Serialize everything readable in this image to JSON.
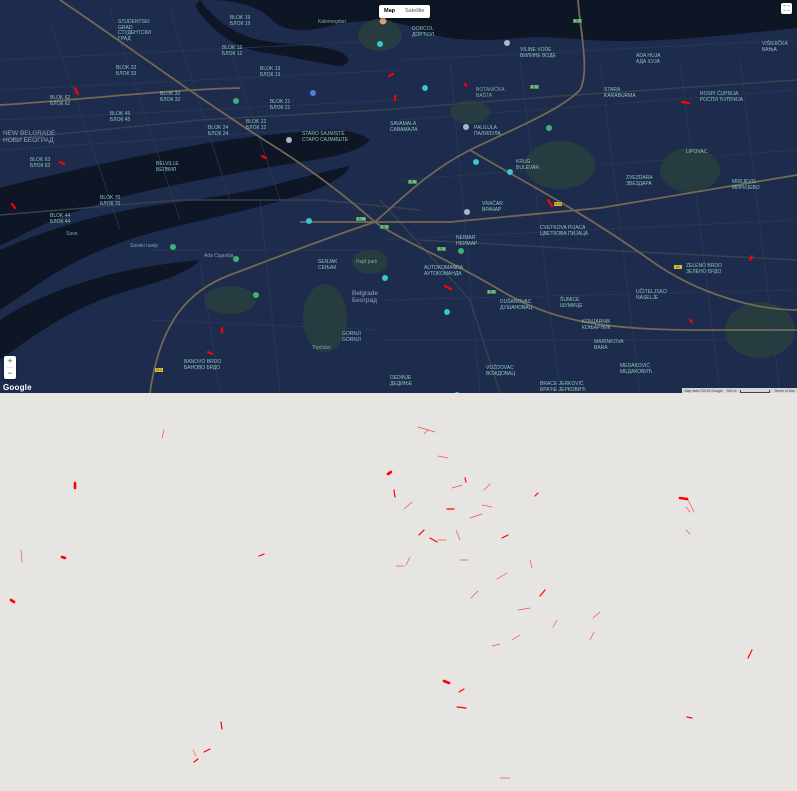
{
  "map_type": {
    "map_label": "Map",
    "satellite_label": "Satellite",
    "selected": "Map"
  },
  "controls": {
    "zoom_in": "+",
    "zoom_out": "−",
    "fullscreen_glyph": "⛶"
  },
  "branding": {
    "logo": "Google"
  },
  "attribution": {
    "data": "Map data ©2019 Google",
    "scale": "500 m",
    "terms": "Terms of Use"
  },
  "theme": {
    "land": "#1d2c4d",
    "water": "#0e1626",
    "road": "#38414e",
    "highway": "#746855",
    "park": "#263c3f",
    "label": "#8ec3b9",
    "accent": "#ff0000",
    "lower_bg": "#e6e5e2"
  },
  "labels": [
    {
      "text": "STUDENTSKI\nGRAD\nСТУДЕНТСКИ\nГРАД"
    },
    {
      "text": "BLOK 19\nБЛОК 19"
    },
    {
      "text": "BLOK 12\nБЛОК 12"
    },
    {
      "text": "BLOK 13\nБЛОК 13"
    },
    {
      "text": "BLOK 33\nБЛОК 33"
    },
    {
      "text": "BLOK 32\nБЛОК 32"
    },
    {
      "text": "BLOK 62\nБЛОК 62"
    },
    {
      "text": "BLOK 45\nБЛОК 45"
    },
    {
      "text": "BLOK 21\nБЛОК 21"
    },
    {
      "text": "BLOK 22\nБЛОК 22"
    },
    {
      "text": "BLOK 24\nБЛОК 24"
    },
    {
      "text": "NEW BELGRADE\nНОВИ БЕОГРАД"
    },
    {
      "text": "BLOK 63\nБЛОК 63"
    },
    {
      "text": "BELVILLE\nБЕЛВИЛ"
    },
    {
      "text": "BLOK 70\nБЛОК 70"
    },
    {
      "text": "BLOK 44\nБЛОК 44"
    },
    {
      "text": "STARO SAJMISTE\nСТАРО САЈМИШТЕ"
    },
    {
      "text": "SAVAMALA\nСАВАМАЛА"
    },
    {
      "text": "PALILULA\nПАЛИЛУЛА"
    },
    {
      "text": "DORCOL\nДОРЋОЛ"
    },
    {
      "text": "VILINE VODE\nВИЛИНЕ ВОДЕ"
    },
    {
      "text": "ADA HUJA\nАДА ХУЈА"
    },
    {
      "text": "VIŠNJIČKA\nБАЊА"
    },
    {
      "text": "STARA\nKARABURMA"
    },
    {
      "text": "ROSPI ĆUPRIJA\nРОСПИ ЋУПРИЈА"
    },
    {
      "text": "BOTANIČKA\nBAŠTA"
    },
    {
      "text": "KRUG\nBULEVAR"
    },
    {
      "text": "ZVEZDARA\nЗВЕЗДАРА"
    },
    {
      "text": "MIRIJEVO\nМИРИЈЕВО"
    },
    {
      "text": "CVETKOVA PIJACA\nЦВЕТКОВА ПИЈАЦА"
    },
    {
      "text": "LIPOVAC"
    },
    {
      "text": "VRAČAR\nВРАЧАР"
    },
    {
      "text": "NEIMAR\nНЕИМАР"
    },
    {
      "text": "SENJAK\nСЕЊАК"
    },
    {
      "text": "Belgrade\nБеоград"
    },
    {
      "text": "AUTOKOMANDA\nАУТОКОМАНДА"
    },
    {
      "text": "DUŠANOVAC\nДУШАНОВАЦ"
    },
    {
      "text": "ŠUMICE\nШУМИЦЕ"
    },
    {
      "text": "UČITELJSKO\nNASELJE"
    },
    {
      "text": "ZELENO BRDO\nЗЕЛЕНО БРДО"
    },
    {
      "text": "KONJARNIK\nКОЊАРНИК"
    },
    {
      "text": "MARINKOVA\nBARA"
    },
    {
      "text": "MEDAKOVIĆ\nМЕДАКОВИЋ"
    },
    {
      "text": "BRACE JERKOVIĆ\nБРАЋЕ ЈЕРКОВИЋ"
    },
    {
      "text": "VOŽDOVAC\nВОЖДОВАЦ"
    },
    {
      "text": "DEDINJE\nДЕДИЊЕ"
    },
    {
      "text": "GORNJI\nGORNJI"
    },
    {
      "text": "BANOVO BRDO\nБАНОВО БРДО"
    },
    {
      "text": "Topčider"
    },
    {
      "text": "Hajd park"
    },
    {
      "text": "Ada Ciganlija"
    },
    {
      "text": "Sava"
    },
    {
      "text": "Kalemegdan"
    },
    {
      "text": "Savski nasip"
    }
  ],
  "pois": [
    {
      "type": "teal"
    },
    {
      "type": "teal"
    },
    {
      "type": "grey"
    },
    {
      "type": "green"
    },
    {
      "type": "blue"
    },
    {
      "type": "teal"
    },
    {
      "type": "grey"
    },
    {
      "type": "green"
    },
    {
      "type": "teal"
    },
    {
      "type": "grey"
    },
    {
      "type": "teal"
    },
    {
      "type": "grey"
    },
    {
      "type": "teal"
    },
    {
      "type": "green"
    },
    {
      "type": "green"
    },
    {
      "type": "green"
    },
    {
      "type": "teal"
    },
    {
      "type": "green"
    },
    {
      "type": "orange"
    },
    {
      "type": "teal"
    }
  ],
  "shields": [
    "E-75",
    "E-70",
    "E-75",
    "E-763",
    "E-70",
    "M-22",
    "A1",
    "E-70",
    "E-75",
    "M-1"
  ],
  "lower_segments": "red traffic segments (no visible text)"
}
